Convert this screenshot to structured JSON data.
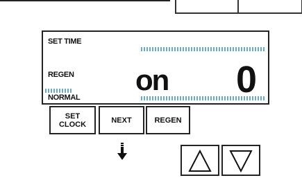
{
  "display": {
    "set_time_label": "SET TIME",
    "regen_label": "REGEN",
    "normal_label": "NORMAL",
    "main_text": "on",
    "digit": "0"
  },
  "buttons": {
    "set_clock": "SET\nCLOCK",
    "next": "NEXT",
    "regen": "REGEN"
  },
  "icons": {
    "down_indicator": "down-arrow-icon",
    "up_button": "triangle-up-icon",
    "down_button": "triangle-down-icon"
  },
  "colors": {
    "indicator_hash": "#6aa8c8",
    "text": "#111111"
  }
}
